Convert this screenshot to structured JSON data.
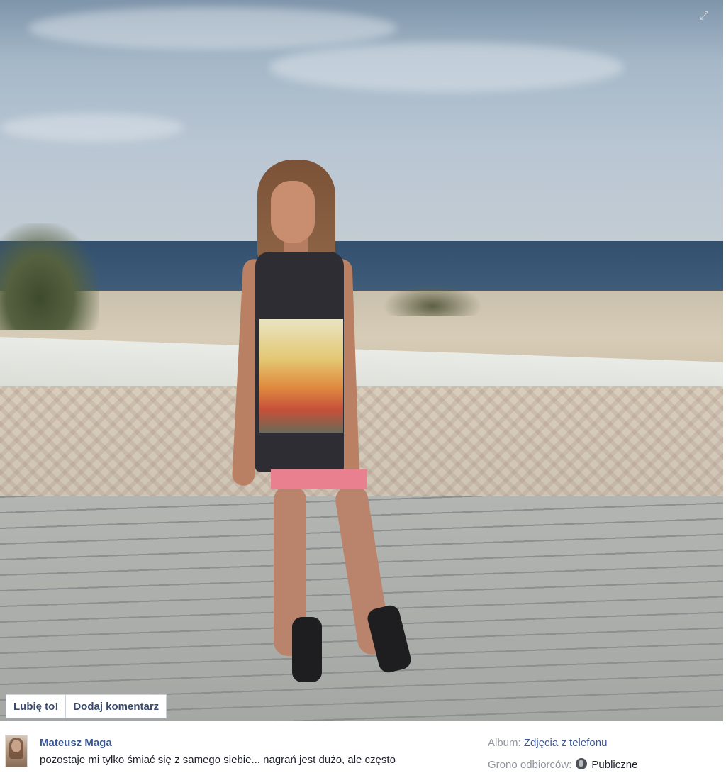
{
  "post": {
    "actions": {
      "like_label": "Lubię to!",
      "comment_label": "Dodaj komentarz"
    },
    "author": "Mateusz Maga",
    "caption": "pozostaje mi tylko śmiać się z samego siebie... nagrań jest dużo, ale często",
    "album_label": "Album:",
    "album_value": "Zdjęcia z telefonu",
    "audience_label": "Grono odbiorców:",
    "audience_value": "Publiczne",
    "icons": {
      "expand": "expand-icon",
      "audience": "globe-icon"
    }
  },
  "colors": {
    "link": "#3b5998",
    "meta_gray": "#90949c",
    "button_text": "#3b4a6d"
  }
}
